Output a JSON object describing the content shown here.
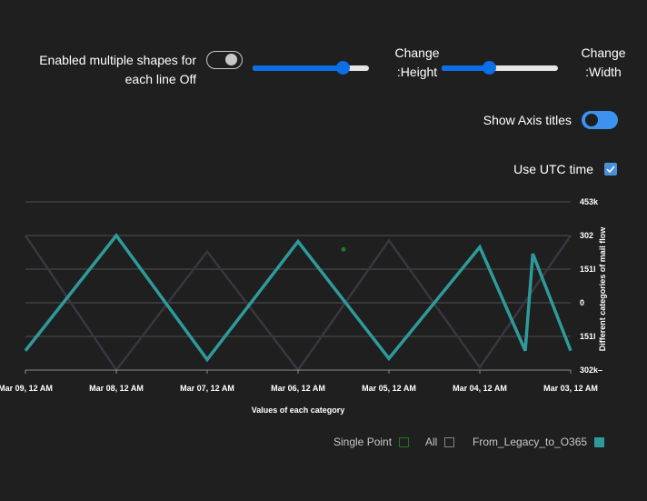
{
  "controls": {
    "multi_shapes_label_line1": "Enabled multiple shapes for",
    "multi_shapes_label_line2": "each line Off",
    "height_label_line1": "Change",
    "height_label_line2": ":Height",
    "width_label_line1": "Change",
    "width_label_line2": ":Width",
    "height_slider_value": 0.81,
    "width_slider_value": 0.4,
    "multi_shapes_enabled": false,
    "axis_titles_label": "Show Axis titles",
    "axis_titles_enabled": true,
    "utc_label": "Use UTC time",
    "utc_checked": true
  },
  "colors": {
    "background": "#1f1f1f",
    "series_main": "#2e9a9a",
    "series_all": "#3a3540",
    "series_single_point": "#1f7a1f",
    "grid": "#555555",
    "toggle_on": "#3d92f0",
    "slider": "#0b6fe8"
  },
  "chart_data": {
    "type": "line",
    "xlabel": "Values of each category",
    "ylabel": "Different categories of mail flow",
    "y_ticks": [
      "453k",
      "302",
      "151l",
      "0",
      "151l",
      "302k–"
    ],
    "y_tick_values": [
      453000,
      302000,
      151000,
      0,
      -151000,
      -302000
    ],
    "ylim": [
      -302000,
      453000
    ],
    "x_ticks": [
      "Mar 09, 12 AM",
      "Mar 08, 12 AM",
      "Mar 07, 12 AM",
      "Mar 06, 12 AM",
      "Mar 05, 12 AM",
      "Mar 04, 12 AM",
      "Mar 03, 12 AM"
    ],
    "x_reversed": true,
    "x_start": "2024-03-09T00:00:00",
    "x_end": "2024-03-03T00:00:00",
    "grid": true,
    "legend_position": "bottom-right",
    "series": [
      {
        "name": "From_Legacy_to_O365",
        "color": "#2e9a9a",
        "x": [
          "2024-03-09T00:00:00",
          "2024-03-08T00:00:00",
          "2024-03-07T00:00:00",
          "2024-03-06T00:00:00",
          "2024-03-05T00:00:00",
          "2024-03-04T00:00:00",
          "2024-03-03T12:00:00",
          "2024-03-03T10:00:00",
          "2024-03-03T00:00:00"
        ],
        "values": [
          -215000,
          302000,
          -255000,
          275000,
          -250000,
          250000,
          -215000,
          220000,
          -215000
        ]
      },
      {
        "name": "All",
        "color": "#3a3540",
        "x": [
          "2024-03-09T00:00:00",
          "2024-03-08T00:00:00",
          "2024-03-07T00:00:00",
          "2024-03-06T00:00:00",
          "2024-03-05T00:00:00",
          "2024-03-04T00:00:00",
          "2024-03-03T00:00:00"
        ],
        "values": [
          302000,
          -302000,
          230000,
          -302000,
          280000,
          -290000,
          302000
        ]
      },
      {
        "name": "Single Point",
        "color": "#1f7a1f",
        "x": [
          "2024-03-05T12:00:00"
        ],
        "values": [
          240000
        ]
      }
    ]
  }
}
